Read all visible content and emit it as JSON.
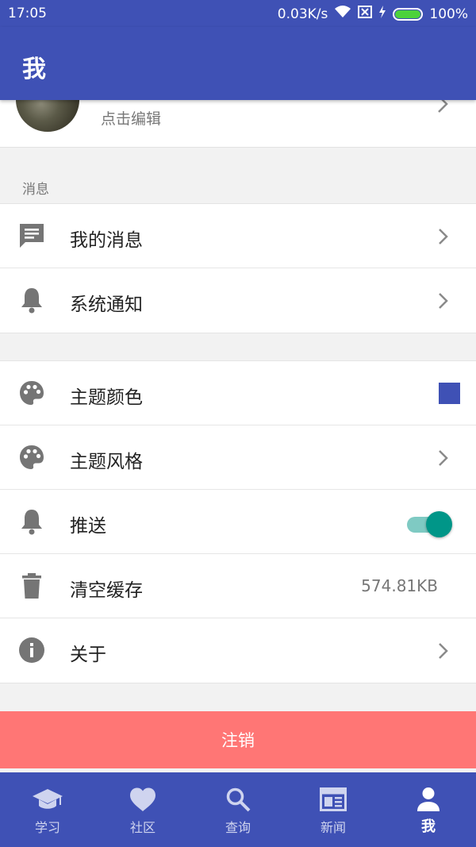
{
  "status_bar": {
    "time": "17:05",
    "net_speed": "0.03K/s",
    "battery": "100%",
    "battery_level": 1.0
  },
  "app_bar": {
    "title": "我"
  },
  "profile": {
    "hint": "点击编辑"
  },
  "sections": {
    "messages_label": "消息"
  },
  "messages": [
    {
      "label": "我的消息",
      "icon": "message-icon"
    },
    {
      "label": "系统通知",
      "icon": "bell-icon"
    }
  ],
  "settings": {
    "theme_color": {
      "label": "主题颜色",
      "icon": "palette-icon",
      "color": "#3f51b5"
    },
    "theme_style": {
      "label": "主题风格",
      "icon": "palette-icon"
    },
    "push": {
      "label": "推送",
      "icon": "bell-icon",
      "enabled": true
    },
    "clear_cache": {
      "label": "清空缓存",
      "icon": "trash-icon",
      "value": "574.81KB"
    },
    "about": {
      "label": "关于",
      "icon": "info-icon"
    }
  },
  "logout": {
    "label": "注销"
  },
  "bottom_nav": [
    {
      "label": "学习",
      "icon": "graduation-cap-icon",
      "active": false
    },
    {
      "label": "社区",
      "icon": "heart-icon",
      "active": false
    },
    {
      "label": "查询",
      "icon": "search-icon",
      "active": false
    },
    {
      "label": "新闻",
      "icon": "newspaper-icon",
      "active": false
    },
    {
      "label": "我",
      "icon": "person-icon",
      "active": true
    }
  ],
  "colors": {
    "primary": "#3f51b5",
    "accent": "#009688",
    "logout": "#ff7675"
  }
}
